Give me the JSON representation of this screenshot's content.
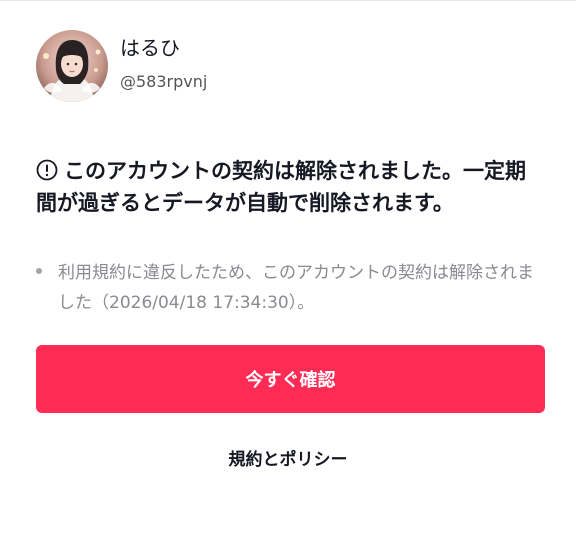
{
  "profile": {
    "display_name": "はるひ",
    "handle": "@583rpvnj"
  },
  "notice": {
    "icon": "info-circle-icon",
    "title": "このアカウントの契約は解除されました。一定期間が過ぎるとデータが自動で削除されます。",
    "detail": "利用規約に違反したため、このアカウントの契約は解除されました（2026/04/18 17:34:30）。"
  },
  "actions": {
    "confirm_label": "今すぐ確認",
    "policy_label": "規約とポリシー"
  },
  "colors": {
    "accent": "#fe2c55",
    "text": "#161823",
    "secondary": "#8a8a90"
  }
}
